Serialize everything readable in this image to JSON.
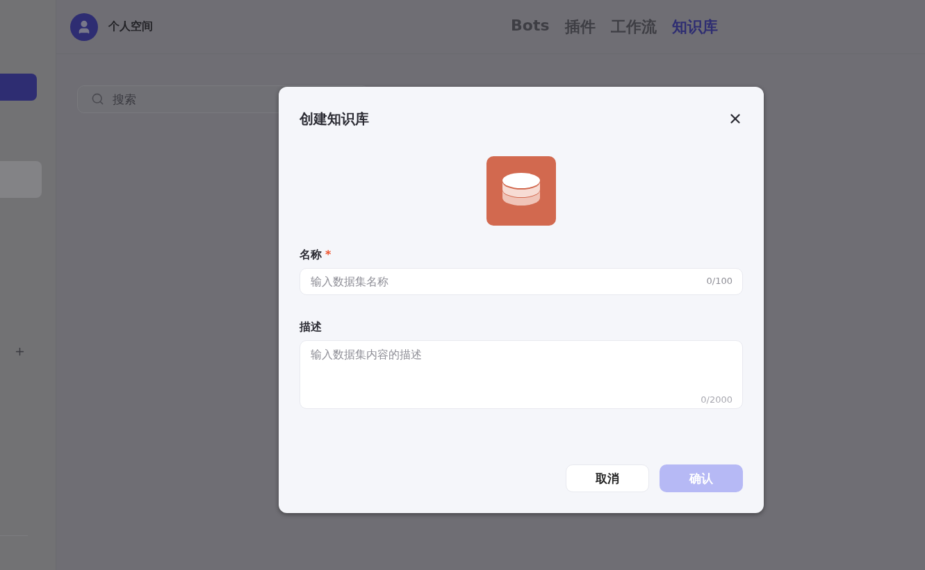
{
  "header": {
    "workspace": "个人空间",
    "nav": [
      {
        "label": "Bots",
        "selected": false
      },
      {
        "label": "插件",
        "selected": false
      },
      {
        "label": "工作流",
        "selected": false
      },
      {
        "label": "知识库",
        "selected": true
      }
    ]
  },
  "search": {
    "placeholder": "搜索"
  },
  "dialog": {
    "title": "创建知识库",
    "fields": [
      {
        "kind": "input",
        "label": "名称",
        "required_mark": "*",
        "placeholder": "输入数据集名称",
        "counter": "0/100"
      },
      {
        "kind": "textarea",
        "label": "描述",
        "placeholder": "输入数据集内容的描述",
        "counter": "0/2000"
      }
    ],
    "buttons": [
      {
        "kind": "secondary",
        "label": "取消",
        "disabled": false
      },
      {
        "kind": "primary",
        "label": "确认",
        "disabled": true
      }
    ]
  }
}
